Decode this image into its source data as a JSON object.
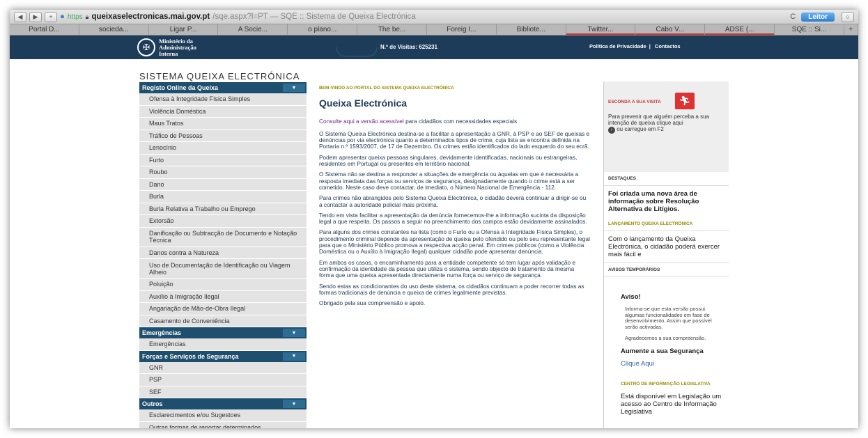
{
  "browser": {
    "url_https": "https",
    "url_domain": "queixaselectronicas.mai.gov.pt",
    "url_path": "/sqe.aspx?l=PT — SQE :: Sistema de Queixa Electrónica",
    "leitor": "Leitor",
    "reload": "C",
    "tabs": [
      "Portal D...",
      "socieda...",
      "Ligar P...",
      "A Socie...",
      "o plano...",
      "The be...",
      "Foreig I...",
      "Bibliote...",
      "Twitter...",
      "Cabo V...",
      "ADSE (...",
      "SQE :: Si..."
    ]
  },
  "header": {
    "ministerio": [
      "Ministério da",
      "Administração",
      "Interna"
    ],
    "visitas": "N.º de Visitas: 625231",
    "politica": "Política de Privacidade",
    "contactos": "Contactos"
  },
  "site_title": "SISTEMA QUEIXA ELECTRÓNICA",
  "sidebar": {
    "registo": {
      "title": "Registo Online da Queixa",
      "items": [
        "Ofensa à Integridade Física Simples",
        "Violência Doméstica",
        "Maus Tratos",
        "Tráfico de Pessoas",
        "Lenocínio",
        "Furto",
        "Roubo",
        "Dano",
        "Burla",
        "Burla Relativa a Trabalho ou Emprego",
        "Extorsão",
        "Danificação ou Subtracção de Documento e Notação Técnica",
        "Danos contra a Natureza",
        "Uso de Documentação de Identificação ou Viagem Alheio",
        "Poluição",
        "Auxílio à Imigração Ilegal",
        "Angariação de Mão-de-Obra Ilegal",
        "Casamento de Conveniência"
      ]
    },
    "emergencias": {
      "title": "Emergências",
      "items": [
        "Emergências"
      ]
    },
    "forcas": {
      "title": "Forças e Serviços de Segurança",
      "items": [
        "GNR",
        "PSP",
        "SEF"
      ]
    },
    "outros": {
      "title": "Outros",
      "items": [
        "Esclarecimentos e/ou Sugestoes",
        "Outras formas de reportar determinados"
      ]
    }
  },
  "main": {
    "bemvindo": "BEM-VINDO AO PORTAL DO SISTEMA QUEIXA ELECTRÓNICA",
    "title": "Queixa Electrónica",
    "consulte_link": "Consulte aqui a versão acessível",
    "consulte_rest": " para cidadãos com necessidades especiais",
    "paragraphs": [
      "O Sistema Queixa Electrónica destina-se a facilitar a apresentação à GNR, à PSP e ao SEF de queixas e denúncias por via electrónica quanto a determinados tipos de crime, cuja lista se encontra definida na Portaria n.º 1593/2007, de 17 de Dezembro. Os crimes estão identificados do lado esquerdo do seu ecrã.",
      "Podem apresentar queixa pessoas singulares, devidamente identificadas, nacionais ou estrangeiras, residentes em Portugal ou presentes em território nacional.",
      "O Sistema não se destina a responder a situações de emergência ou àquelas em que é necessária a resposta imediata das forças ou serviços de segurança, designadamente quando o crime está a ser cometido. Neste caso deve contactar, de imediato, o Número Nacional de Emergência - 112.",
      "Para crimes não abrangidos pelo Sistema Queixa Electrónica, o cidadão deverá continuar a dirigir-se ou a contactar a autoridade policial mais próxima.",
      "Tendo em vista facilitar a apresentação da denúncia fornecemos-lhe a informação sucinta da disposição legal a que respeita. Os passos a seguir no preenchimento dos campos estão devidamente assinalados.",
      "Para alguns dos crimes constantes na lista (como o Furto ou a Ofensa à Integridade Física Simples), o procedimento criminal depende da apresentação de queixa pelo ofendido ou pelo seu representante legal para que o Ministério Público promova a respectiva acção penal. Em crimes públicos (como a Violência Doméstica ou o Auxílio à Imigração Ilegal) qualquer cidadão pode apresentar denúncia.",
      "Em ambos os casos, o encaminhamento para a entidade competente só tem lugar após validação e confirmação da identidade da pessoa que utiliza o sistema, sendo objecto de tratamento da mesma forma que uma queixa apresentada directamente numa força ou serviço de segurança.",
      "Sendo estas as condicionantes do uso deste sistema, os cidadãos continuam a poder recorrer todas as formas tradicionais de denúncia e queixa de crimes legalmente previstas.",
      "Obrigado pela sua compreensão e apoio."
    ]
  },
  "right": {
    "esconda": "ESCONDA A SUA VISITA",
    "esconda_text": "Para prevenir que alguém perceba a sua intenção de queixa clique aqui",
    "ou_carregue": " ou carregue em F2",
    "destaques": "DESTAQUES",
    "destaque_text": "Foi criada uma nova área de informação sobre Resolução Alternativa de Litígios.",
    "lancamento": "LANÇAMENTO QUEIXA ELECTRÓNICA",
    "lancamento_text": "Com o lançamento da Queixa Electrónica, o cidadão poderá exercer mais fácil e",
    "avisos": "AVISOS TEMPORÁRIOS",
    "aviso": "Aviso!",
    "aviso_text": "Informa-se que esta versão possui algumas funcionalidades em fase de desenvolvimento. Assim que possível serão activadas.",
    "agradecemos": "Agradecemos a sua compreensão.",
    "aumente": "Aumente a sua Segurança",
    "clique": "Clique Aqui",
    "centro": "CENTRO DE INFORMAÇÃO LEGISLATIVA",
    "esta": "Está disponível em Legislação um acesso ao Centro de Informação Legislativa"
  }
}
